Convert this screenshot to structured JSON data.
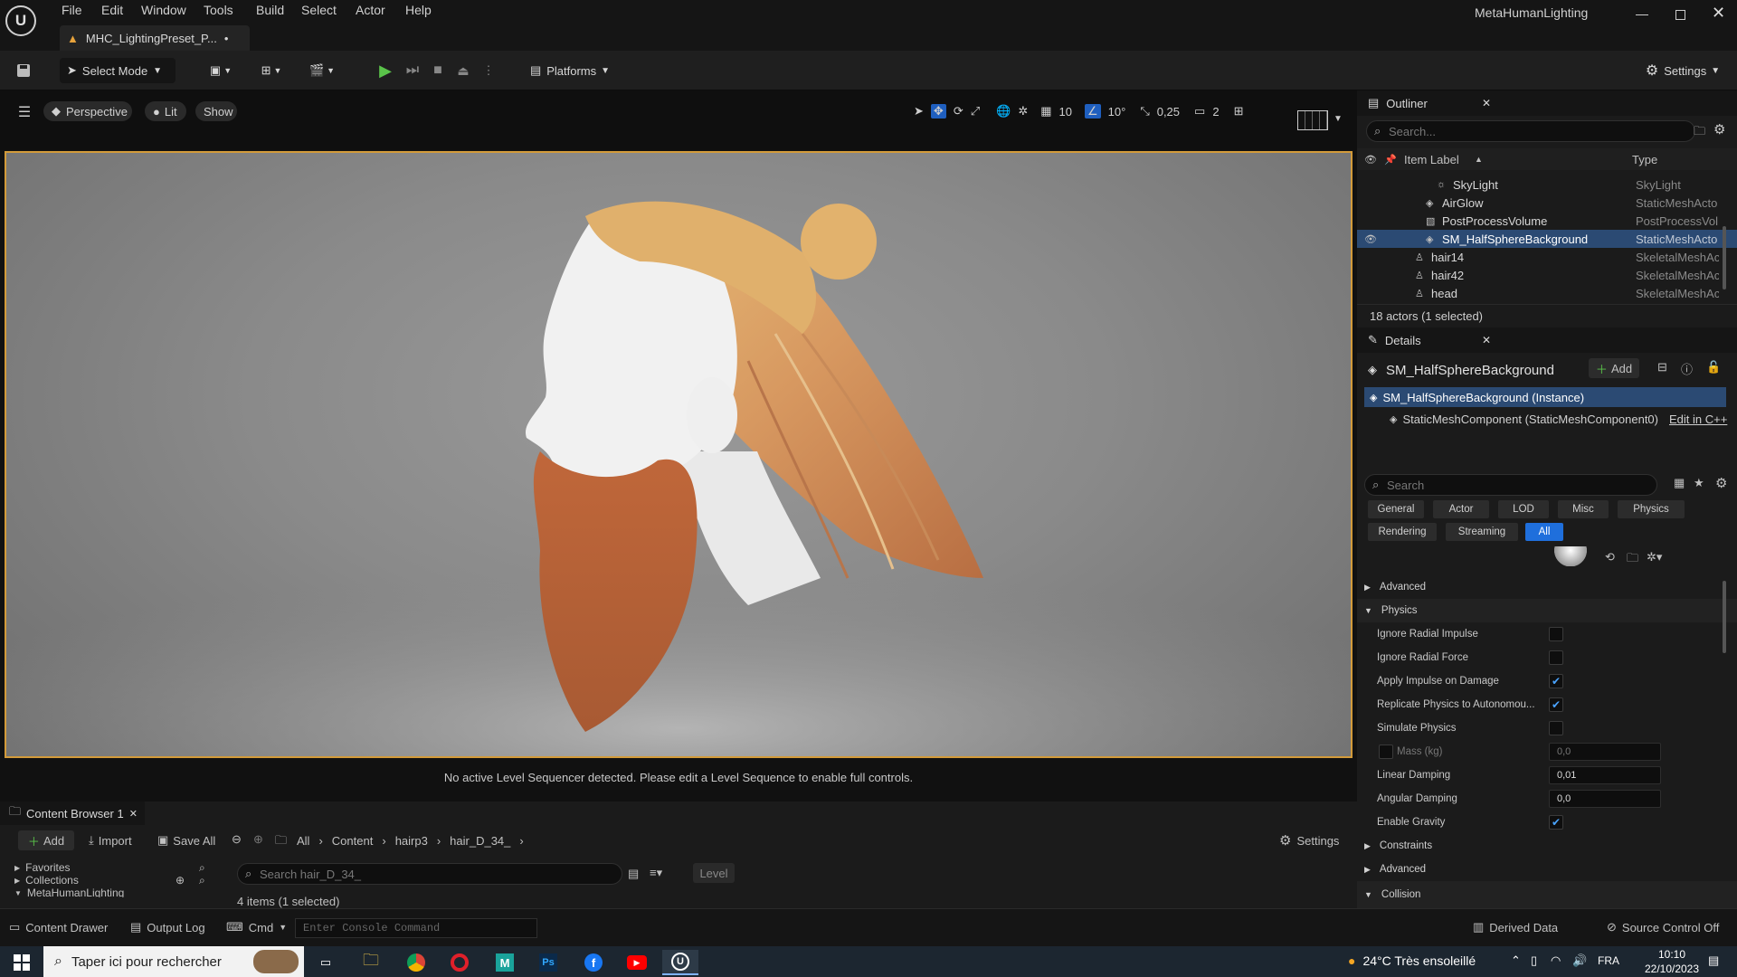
{
  "titlebar": {
    "app_title": "MetaHumanLighting",
    "doc_tab": "MHC_LightingPreset_P...",
    "dirty_marker": "•",
    "menu": [
      "File",
      "Edit",
      "Window",
      "Tools",
      "Build",
      "Select",
      "Actor",
      "Help"
    ]
  },
  "toolbar": {
    "select_mode": "Select Mode",
    "platforms": "Platforms",
    "settings": "Settings"
  },
  "viewport": {
    "perspective": "Perspective",
    "lit": "Lit",
    "show": "Show",
    "grid_size": "10",
    "rotation_snap": "10°",
    "scale_snap": "0,25",
    "camera_speed": "2",
    "sequencer_message": "No active Level Sequencer detected. Please edit a Level Sequence to enable full controls."
  },
  "outliner": {
    "tab": "Outliner",
    "search_placeholder": "Search...",
    "col_label": "Item Label",
    "col_type": "Type",
    "rows": [
      {
        "label": "SkyLight",
        "type": "SkyLight"
      },
      {
        "label": "AirGlow",
        "type": "StaticMeshActo"
      },
      {
        "label": "PostProcessVolume",
        "type": "PostProcessVol"
      },
      {
        "label": "SM_HalfSphereBackground",
        "type": "StaticMeshActo"
      },
      {
        "label": "hair14",
        "type": "SkeletalMeshAc"
      },
      {
        "label": "hair42",
        "type": "SkeletalMeshAc"
      },
      {
        "label": "head",
        "type": "SkeletalMeshAc"
      }
    ],
    "footer": "18 actors (1 selected)"
  },
  "details": {
    "tab": "Details",
    "actor_name": "SM_HalfSphereBackground",
    "add": "Add",
    "instance": "SM_HalfSphereBackground (Instance)",
    "component": "StaticMeshComponent (StaticMeshComponent0)",
    "edit_cpp": "Edit in C++",
    "search_placeholder": "Search",
    "categories_row1": [
      "General",
      "Actor",
      "LOD",
      "Misc",
      "Physics"
    ],
    "categories_row2": [
      "Rendering",
      "Streaming",
      "All"
    ],
    "sections": {
      "advanced": "Advanced",
      "physics": "Physics",
      "constraints": "Constraints",
      "advanced2": "Advanced",
      "collision": "Collision"
    },
    "props": {
      "ignore_radial_impulse": "Ignore Radial Impulse",
      "ignore_radial_force": "Ignore Radial Force",
      "apply_impulse": "Apply Impulse on Damage",
      "replicate_physics": "Replicate Physics to Autonomou...",
      "simulate_physics": "Simulate Physics",
      "mass": "Mass (kg)",
      "mass_value": "0,0",
      "linear_damping": "Linear Damping",
      "linear_damping_value": "0,01",
      "angular_damping": "Angular Damping",
      "angular_damping_value": "0,0",
      "enable_gravity": "Enable Gravity"
    }
  },
  "content_browser": {
    "tab": "Content Browser 1",
    "add": "Add",
    "import": "Import",
    "save_all": "Save All",
    "breadcrumb": [
      "All",
      "Content",
      "hairp3",
      "hair_D_34_"
    ],
    "settings": "Settings",
    "favorites": "Favorites",
    "collections": "Collections",
    "metahuman": "MetaHumanLighting",
    "search_placeholder": "Search hair_D_34_",
    "level_filter": "Level",
    "count": "4 items (1 selected)"
  },
  "statusbar": {
    "content_drawer": "Content Drawer",
    "output_log": "Output Log",
    "cmd": "Cmd",
    "console_placeholder": "Enter Console Command",
    "derived_data": "Derived Data",
    "source_control": "Source Control Off"
  },
  "taskbar": {
    "search": "Taper ici pour rechercher",
    "weather": "24°C  Très ensoleillé",
    "lang": "FRA",
    "time": "10:10",
    "date": "22/10/2023"
  }
}
